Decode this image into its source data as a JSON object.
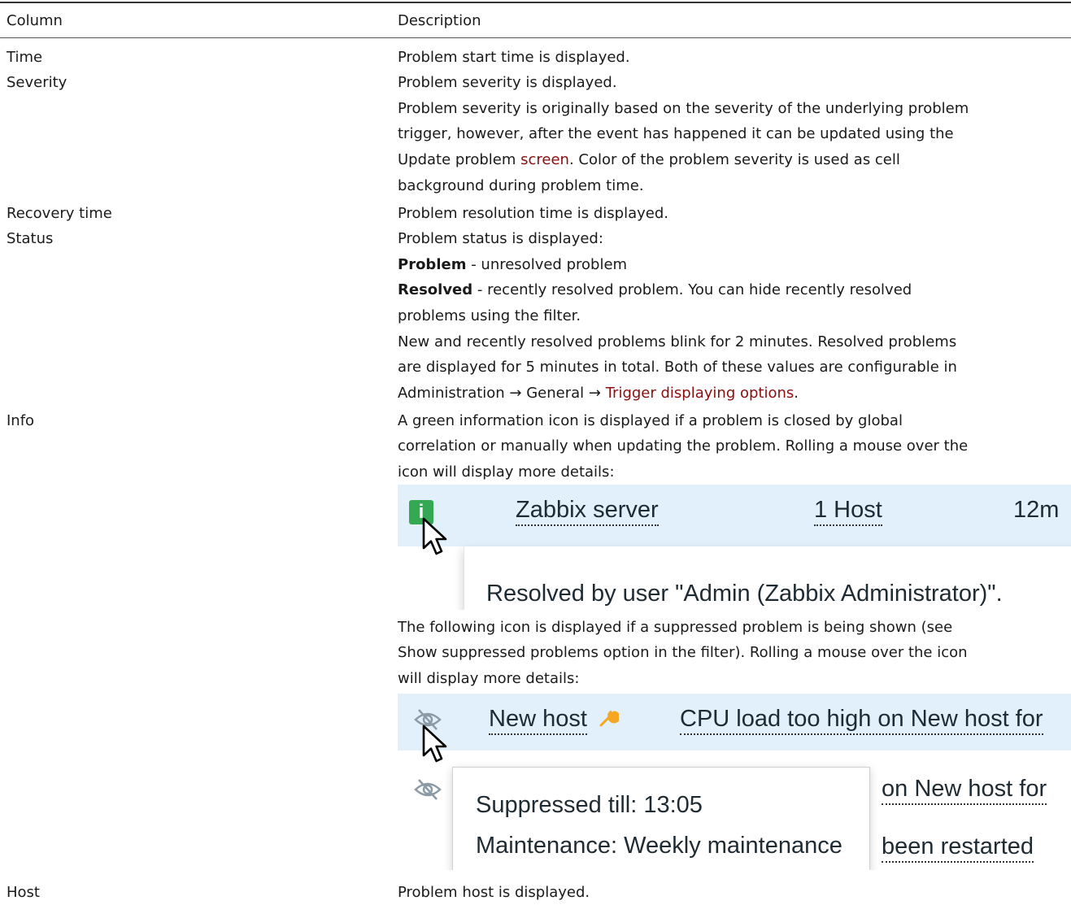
{
  "header": {
    "col1": "Column",
    "col2": "Description"
  },
  "rows": {
    "time": {
      "name": "Time",
      "desc": "Problem start time is displayed."
    },
    "severity": {
      "name": "Severity",
      "desc1": "Problem severity is displayed.",
      "desc2": "Problem severity is originally based on the severity of the underlying problem",
      "desc3": "trigger, however, after the event has happened it can be updated using the",
      "desc4_pre": "Update problem ",
      "desc4_link": "screen",
      "desc4_post": ". Color of the problem severity is used as cell",
      "desc5": "background during problem time."
    },
    "recovery": {
      "name": "Recovery time",
      "desc": "Problem resolution time is displayed."
    },
    "status": {
      "name": "Status",
      "desc1": "Problem status is displayed:",
      "problem_bold": "Problem",
      "problem_rest": " - unresolved problem",
      "resolved_bold": "Resolved",
      "resolved_rest": " - recently resolved problem. You can hide recently resolved",
      "desc4": "problems using the filter.",
      "desc5": "New and recently resolved problems blink for 2 minutes. Resolved problems",
      "desc6": "are displayed for 5 minutes in total. Both of these values are configurable in",
      "desc7_pre": "Administration → General → ",
      "desc7_link": "Trigger displaying options",
      "desc7_post": "."
    },
    "info": {
      "name": "Info",
      "desc1": "A green information icon is displayed if a problem is closed by global",
      "desc2": "correlation or manually when updating the problem. Rolling a mouse over the",
      "desc3": "icon will display more details:",
      "desc4": "The following icon is displayed if a suppressed problem is being shown (see",
      "desc5": "Show suppressed problems option in the filter). Rolling a mouse over the icon",
      "desc6": "will display more details:"
    },
    "host": {
      "name": "Host",
      "desc": "Problem host is displayed."
    }
  },
  "shot1": {
    "icon_letter": "i",
    "host": "Zabbix server",
    "hosts_count": "1 Host",
    "duration": "12m",
    "tooltip": "Resolved by user \"Admin (Zabbix Administrator)\"."
  },
  "shot2": {
    "host": "New host",
    "trigger": "CPU load too high on New host for",
    "row2_partial": "on New host for",
    "tooltip_line1": "Suppressed till: 13:05",
    "tooltip_line2": "Maintenance: Weekly maintenance",
    "row3_partial": "been restarted"
  },
  "colors": {
    "link": "#8b0e0e",
    "row_highlight": "#e2f0fb",
    "info_green": "#34a853",
    "wrench": "#f5a623"
  }
}
